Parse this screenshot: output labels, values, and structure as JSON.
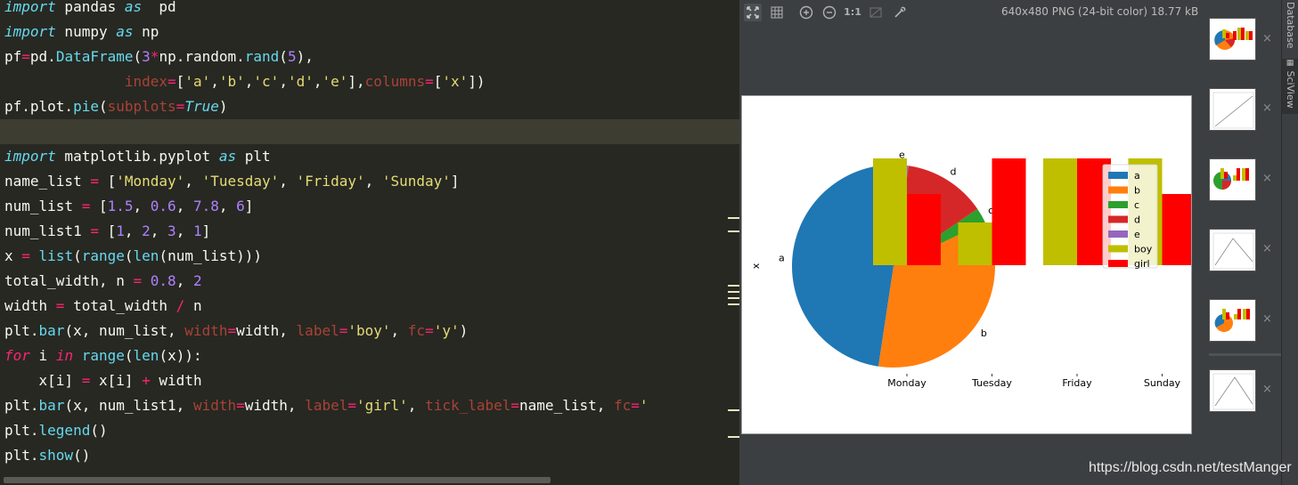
{
  "editor": {
    "lines": [
      [
        [
          "kw",
          "import"
        ],
        [
          "t",
          " pandas "
        ],
        [
          "kw",
          "as"
        ],
        [
          "t",
          "  pd"
        ]
      ],
      [
        [
          "kw",
          "import"
        ],
        [
          "t",
          " numpy "
        ],
        [
          "kw",
          "as"
        ],
        [
          "t",
          " np"
        ]
      ],
      [
        [
          "t",
          "pf"
        ],
        [
          "op",
          "="
        ],
        [
          "t",
          "pd."
        ],
        [
          "fn",
          "DataFrame"
        ],
        [
          "t",
          "("
        ],
        [
          "num",
          "3"
        ],
        [
          "op",
          "*"
        ],
        [
          "t",
          "np.random."
        ],
        [
          "fn",
          "rand"
        ],
        [
          "t",
          "("
        ],
        [
          "num",
          "5"
        ],
        [
          "t",
          "),"
        ]
      ],
      [
        [
          "t",
          "              "
        ],
        [
          "arg",
          "index"
        ],
        [
          "op",
          "="
        ],
        [
          "t",
          "["
        ],
        [
          "str",
          "'a'"
        ],
        [
          "t",
          ","
        ],
        [
          "str",
          "'b'"
        ],
        [
          "t",
          ","
        ],
        [
          "str",
          "'c'"
        ],
        [
          "t",
          ","
        ],
        [
          "str",
          "'d'"
        ],
        [
          "t",
          ","
        ],
        [
          "str",
          "'e'"
        ],
        [
          "t",
          "],"
        ],
        [
          "arg",
          "columns"
        ],
        [
          "op",
          "="
        ],
        [
          "t",
          "["
        ],
        [
          "str",
          "'x'"
        ],
        [
          "t",
          "])"
        ]
      ],
      [
        [
          "t",
          "pf.plot."
        ],
        [
          "fn",
          "pie"
        ],
        [
          "t",
          "("
        ],
        [
          "arg",
          "subplots"
        ],
        [
          "op",
          "="
        ],
        [
          "const",
          "True"
        ],
        [
          "t",
          ")"
        ]
      ],
      [
        [
          "t",
          ""
        ]
      ],
      [
        [
          "kw",
          "import"
        ],
        [
          "t",
          " matplotlib.pyplot "
        ],
        [
          "kw",
          "as"
        ],
        [
          "t",
          " plt"
        ]
      ],
      [
        [
          "t",
          "name_list "
        ],
        [
          "op",
          "="
        ],
        [
          "t",
          " ["
        ],
        [
          "str",
          "'Monday'"
        ],
        [
          "t",
          ", "
        ],
        [
          "str",
          "'Tuesday'"
        ],
        [
          "t",
          ", "
        ],
        [
          "str",
          "'Friday'"
        ],
        [
          "t",
          ", "
        ],
        [
          "str",
          "'Sunday'"
        ],
        [
          "t",
          "]"
        ]
      ],
      [
        [
          "t",
          "num_list "
        ],
        [
          "op",
          "="
        ],
        [
          "t",
          " ["
        ],
        [
          "num",
          "1.5"
        ],
        [
          "t",
          ", "
        ],
        [
          "num",
          "0.6"
        ],
        [
          "t",
          ", "
        ],
        [
          "num",
          "7.8"
        ],
        [
          "t",
          ", "
        ],
        [
          "num",
          "6"
        ],
        [
          "t",
          "]"
        ]
      ],
      [
        [
          "t",
          "num_list1 "
        ],
        [
          "op",
          "="
        ],
        [
          "t",
          " ["
        ],
        [
          "num",
          "1"
        ],
        [
          "t",
          ", "
        ],
        [
          "num",
          "2"
        ],
        [
          "t",
          ", "
        ],
        [
          "num",
          "3"
        ],
        [
          "t",
          ", "
        ],
        [
          "num",
          "1"
        ],
        [
          "t",
          "]"
        ]
      ],
      [
        [
          "t",
          "x "
        ],
        [
          "op",
          "="
        ],
        [
          "t",
          " "
        ],
        [
          "fn",
          "list"
        ],
        [
          "t",
          "("
        ],
        [
          "fn",
          "range"
        ],
        [
          "t",
          "("
        ],
        [
          "fn",
          "len"
        ],
        [
          "t",
          "(num_list)))"
        ]
      ],
      [
        [
          "t",
          "total_width, n "
        ],
        [
          "op",
          "="
        ],
        [
          "t",
          " "
        ],
        [
          "num",
          "0.8"
        ],
        [
          "t",
          ", "
        ],
        [
          "num",
          "2"
        ]
      ],
      [
        [
          "t",
          "width "
        ],
        [
          "op",
          "="
        ],
        [
          "t",
          " total_width "
        ],
        [
          "op",
          "/"
        ],
        [
          "t",
          " n"
        ]
      ],
      [
        [
          "t",
          "plt."
        ],
        [
          "fn",
          "bar"
        ],
        [
          "t",
          "(x, num_list, "
        ],
        [
          "arg",
          "width"
        ],
        [
          "op",
          "="
        ],
        [
          "t",
          "width, "
        ],
        [
          "arg",
          "label"
        ],
        [
          "op",
          "="
        ],
        [
          "str",
          "'boy'"
        ],
        [
          "t",
          ", "
        ],
        [
          "arg",
          "fc"
        ],
        [
          "op",
          "="
        ],
        [
          "str",
          "'y'"
        ],
        [
          "t",
          ")"
        ]
      ],
      [
        [
          "ctl",
          "for"
        ],
        [
          "t",
          " i "
        ],
        [
          "ctl",
          "in"
        ],
        [
          "t",
          " "
        ],
        [
          "fn",
          "range"
        ],
        [
          "t",
          "("
        ],
        [
          "fn",
          "len"
        ],
        [
          "t",
          "(x)):"
        ]
      ],
      [
        [
          "t",
          "    x[i] "
        ],
        [
          "op",
          "="
        ],
        [
          "t",
          " x[i] "
        ],
        [
          "op",
          "+"
        ],
        [
          "t",
          " width"
        ]
      ],
      [
        [
          "t",
          "plt."
        ],
        [
          "fn",
          "bar"
        ],
        [
          "t",
          "(x, num_list1, "
        ],
        [
          "arg",
          "width"
        ],
        [
          "op",
          "="
        ],
        [
          "t",
          "width, "
        ],
        [
          "arg",
          "label"
        ],
        [
          "op",
          "="
        ],
        [
          "str",
          "'girl'"
        ],
        [
          "t",
          ", "
        ],
        [
          "arg",
          "tick_label"
        ],
        [
          "op",
          "="
        ],
        [
          "t",
          "name_list, "
        ],
        [
          "arg",
          "fc"
        ],
        [
          "op",
          "="
        ],
        [
          "str",
          "'"
        ]
      ],
      [
        [
          "t",
          "plt."
        ],
        [
          "fn",
          "legend"
        ],
        [
          "t",
          "()"
        ]
      ],
      [
        [
          "t",
          "plt."
        ],
        [
          "fn",
          "show"
        ],
        [
          "t",
          "()"
        ]
      ]
    ]
  },
  "viewer": {
    "toolbar": {
      "fit_icon": "fit-to-window-icon",
      "grid_icon": "grid-icon",
      "zoom_in_icon": "zoom-in-icon",
      "zoom_out_icon": "zoom-out-icon",
      "actual_size_label": "1:1",
      "background_icon": "background-icon",
      "picker_icon": "color-picker-icon"
    },
    "image_info": "640x480 PNG (24-bit color) 18.77 kB",
    "thumbnail_close": "×"
  },
  "tool_strip": {
    "tabs": [
      "Database",
      "SciView"
    ]
  },
  "watermark": "https://blog.csdn.net/testManger",
  "chart_data": {
    "type": "bar",
    "pie": {
      "ylabel": "x",
      "labels": [
        "a",
        "b",
        "c",
        "d",
        "e"
      ],
      "shares_percent": [
        40,
        29,
        2,
        11,
        2
      ],
      "colors": [
        "#1f77b4",
        "#ff7f0e",
        "#2ca02c",
        "#d62728",
        "#9467bd"
      ]
    },
    "categories": [
      "Monday",
      "Tuesday",
      "Friday",
      "Sunday"
    ],
    "series": [
      {
        "name": "boy",
        "values": [
          1.5,
          0.6,
          7.8,
          6
        ],
        "color": "#bfbf00"
      },
      {
        "name": "girl",
        "values": [
          1,
          2,
          3,
          1
        ],
        "color": "#ff0000"
      }
    ],
    "legend_entries": [
      "a",
      "b",
      "c",
      "d",
      "e",
      "boy",
      "girl"
    ],
    "legend_position": "upper right",
    "ylim": [
      0,
      1.5
    ]
  }
}
